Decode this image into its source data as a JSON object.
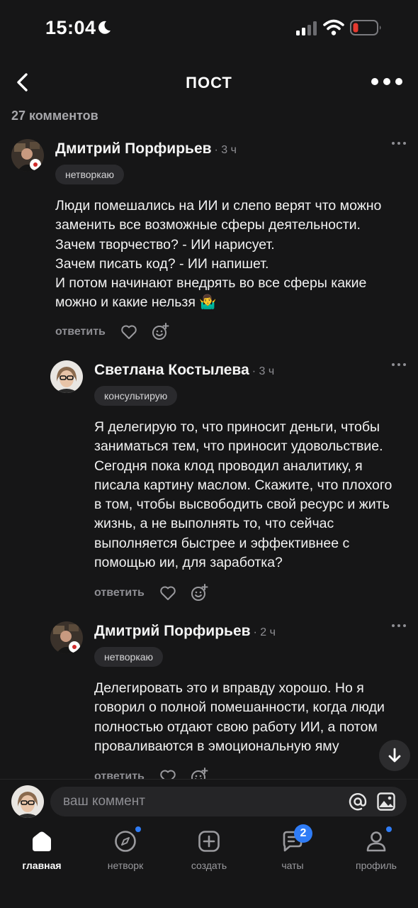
{
  "status_bar": {
    "time": "15:04",
    "icons": [
      "moon-icon",
      "signal-icon",
      "wifi-icon",
      "battery-low-icon"
    ],
    "battery_color": "#e5392f"
  },
  "header": {
    "title": "ПОСТ",
    "back_icon": "chevron-left-icon",
    "more_icon": "more-horizontal-icon"
  },
  "comments_count": "27 комментов",
  "comments": [
    {
      "author": "Дмитрий Порфирьев",
      "time": "· 3 ч",
      "tag": "нетворкаю",
      "lines": [
        "Люди помешались на ИИ и слепо верят что можно",
        "заменить все возможные сферы деятельности.",
        "Зачем творчество? - ИИ нарисует.",
        "Зачем писать код? - ИИ напишет.",
        "И потом начинают внедрять во все сферы какие",
        "можно и какие нельзя 🤷‍♂️"
      ],
      "reply_label": "ответить"
    },
    {
      "author": "Светлана Костылева",
      "time": "· 3 ч",
      "tag": "консультирую",
      "lines": [
        "Я делегирую то, что приносит деньги, чтобы",
        "заниматься тем, что приносит удовольствие.",
        "Сегодня пока клод проводил аналитику, я",
        "писала картину маслом. Скажите, что плохого",
        "в том, чтобы высвободить свой ресурс и жить",
        "жизнь, а не выполнять то, что сейчас",
        "выполняется быстрее и эффективнее с",
        "помощью ии, для заработка?"
      ],
      "reply_label": "ответить"
    },
    {
      "author": "Дмитрий Порфирьев",
      "time": "· 2 ч",
      "tag": "нетворкаю",
      "lines": [
        "Делегировать это и вправду хорошо. Но я",
        "говорил о полной помешанности, когда люди",
        "полностью отдают свою работу ИИ, а потом",
        "проваливаются в эмоциональную яму"
      ],
      "reply_label": "ответить"
    }
  ],
  "input": {
    "placeholder": "ваш коммент"
  },
  "tabs": [
    {
      "label": "главная",
      "icon": "home-icon",
      "active": true
    },
    {
      "label": "нетворк",
      "icon": "compass-icon",
      "dot": true
    },
    {
      "label": "создать",
      "icon": "plus-square-icon"
    },
    {
      "label": "чаты",
      "icon": "chat-icon",
      "badge": "2"
    },
    {
      "label": "профиль",
      "icon": "user-icon",
      "dot": true
    }
  ],
  "colors": {
    "background": "#161617",
    "accent": "#2f7cf6",
    "tag_bg": "#2a2a2d"
  }
}
